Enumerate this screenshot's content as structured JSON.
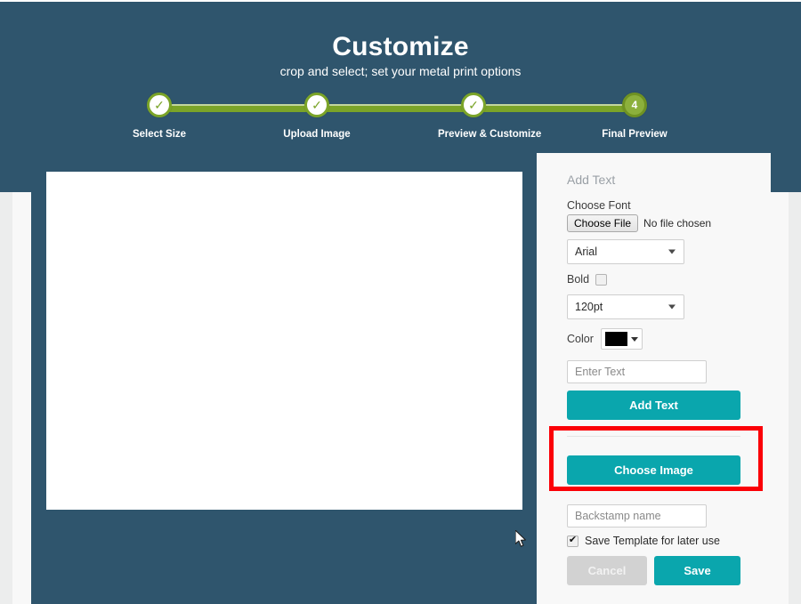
{
  "hero": {
    "title": "Customize",
    "subtitle": "crop and select; set your metal print options"
  },
  "stepper": {
    "steps": [
      {
        "label": "Select Size",
        "state": "complete",
        "marker": "✓"
      },
      {
        "label": "Upload Image",
        "state": "complete",
        "marker": "✓"
      },
      {
        "label": "Preview & Customize",
        "state": "complete",
        "marker": "✓"
      },
      {
        "label": "Final Preview",
        "state": "current",
        "marker": "4"
      }
    ],
    "track_color": "#7ba428",
    "current_color": "#8cb03c"
  },
  "options_panel": {
    "heading": "Add Text",
    "choose_font_label": "Choose Font",
    "choose_file_button": "Choose File",
    "file_status": "No file chosen",
    "font_select": {
      "value": "Arial"
    },
    "bold_label": "Bold",
    "bold_checked": false,
    "size_select": {
      "value": "120pt"
    },
    "color_label": "Color",
    "color_value": "#000000",
    "text_input": {
      "value": "",
      "placeholder": "Enter Text"
    },
    "add_text_button": "Add Text",
    "choose_image_button": "Choose Image",
    "backstamp_input": {
      "value": "",
      "placeholder": "Backstamp name"
    },
    "save_template_label": "Save Template for later use",
    "save_template_checked": true,
    "cancel_button": "Cancel",
    "save_button": "Save"
  },
  "theme": {
    "hero_bg": "#2f556d",
    "teal_button": "#0aa6ad",
    "highlight_border": "#fb0007",
    "panel_bg": "#f8f8f8"
  }
}
